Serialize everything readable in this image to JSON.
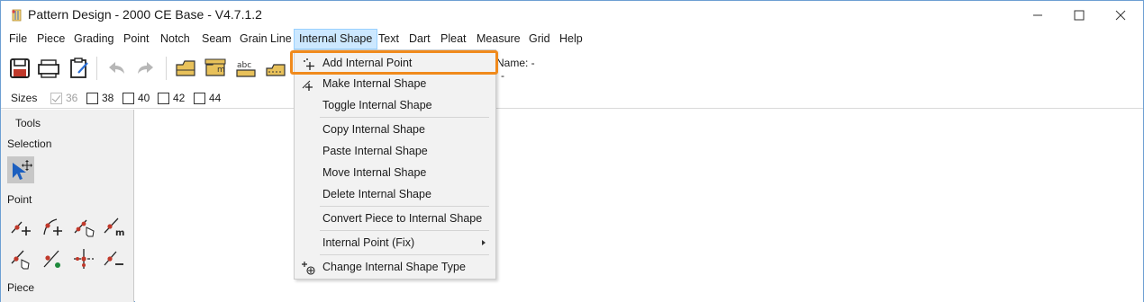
{
  "window": {
    "title": "Pattern Design - 2000 CE Base - V4.7.1.2",
    "controls": {
      "minimize": "—",
      "maximize": "☐",
      "close": "✕"
    }
  },
  "menubar": {
    "items": [
      "File",
      "Piece",
      "Grading",
      "Point",
      "Notch",
      "Seam",
      "Grain Line",
      "Internal Shape",
      "Text",
      "Dart",
      "Pleat",
      "Measure",
      "Grid",
      "Help"
    ],
    "active": "Internal Shape"
  },
  "toolbar": {
    "icons": [
      "save-icon",
      "plotter-icon",
      "clipboard-edit-icon",
      "undo-icon",
      "redo-icon",
      "piece-icon",
      "measure-piece-icon",
      "text-piece-icon",
      "piece-outline-icon"
    ],
    "piece_name_label": "Name: -",
    "piece_info_extra": "-"
  },
  "sizes": {
    "label": "Sizes",
    "items": [
      {
        "value": "36",
        "checked": true,
        "disabled": true
      },
      {
        "value": "38",
        "checked": false,
        "disabled": false
      },
      {
        "value": "40",
        "checked": false,
        "disabled": false
      },
      {
        "value": "42",
        "checked": false,
        "disabled": false
      },
      {
        "value": "44",
        "checked": false,
        "disabled": false
      }
    ]
  },
  "tools": {
    "title": "Tools",
    "sections": {
      "selection": "Selection",
      "point": "Point",
      "piece": "Piece"
    },
    "point_tools": [
      "add-point-icon",
      "add-curve-point-icon",
      "select-point-icon",
      "measure-point-icon",
      "move-point-icon",
      "split-point-icon",
      "intersect-point-icon",
      "delete-point-icon"
    ]
  },
  "dropdown": {
    "items": [
      {
        "label": "Add Internal Point",
        "icon": "add-point-icon",
        "highlighted": true
      },
      {
        "label": "Make Internal Shape",
        "icon": "make-shape-icon"
      },
      {
        "label": "Toggle Internal Shape"
      },
      {
        "label": "Copy Internal Shape"
      },
      {
        "label": "Paste Internal Shape"
      },
      {
        "label": "Move Internal Shape"
      },
      {
        "label": "Delete Internal Shape"
      },
      {
        "label": "Convert Piece to Internal Shape"
      },
      {
        "label": "Internal Point (Fix)",
        "submenu": true
      },
      {
        "label": "Change Internal Shape Type",
        "icon": "change-type-icon"
      }
    ]
  },
  "colors": {
    "highlight": "#f08a1c",
    "menu_active_bg": "#cce8ff",
    "point_red": "#c0392b",
    "point_green": "#1e8a3c",
    "folder_yellow": "#e8c15a"
  }
}
